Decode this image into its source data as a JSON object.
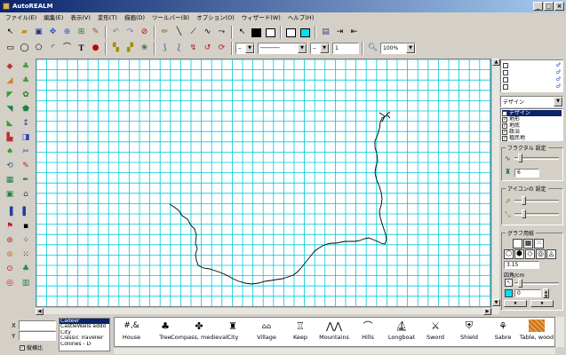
{
  "window": {
    "title": "AutoREALM"
  },
  "menu": [
    "ファイル(E)",
    "編集(E)",
    "表示(V)",
    "変形(T)",
    "描画(D)",
    "ツールバー(B)",
    "オプション(O)",
    "ウィザード(W)",
    "ヘルプ(H)"
  ],
  "toolbar2": {
    "line_width_value": "1",
    "zoom_value": "100%"
  },
  "right_panel": {
    "layer_select": "デザイン",
    "layers": [
      {
        "label": "デザイン",
        "checked": true,
        "selected": true
      },
      {
        "label": "地形",
        "checked": true
      },
      {
        "label": "地底",
        "checked": true
      },
      {
        "label": "政治",
        "checked": true
      },
      {
        "label": "植民地",
        "checked": true
      }
    ],
    "fractal_title": "フラクタル 設定",
    "fractal_value": "6",
    "icon_title": "アイコンの 設定",
    "grid_title": "グラフ用紙",
    "grid_value": "3.15",
    "grid_unit_label": "四角/cm",
    "grid_spin_value": "0"
  },
  "bottom": {
    "x_label": "X",
    "y_label": "Y",
    "checkbox_label": "縦横比",
    "styles": [
      "Cadeer",
      "CastleWalls addo",
      "City",
      "Classic Traveller",
      "Collines - D"
    ],
    "symbols": [
      "House",
      "Tree",
      "Compass, medieval",
      "City",
      "Village",
      "Keep",
      "Mountains",
      "Hills",
      "Longboat",
      "Sword",
      "Shield",
      "Sabre",
      "Table, wood"
    ]
  },
  "colors": {
    "grid": "#00c8d8",
    "title_start": "#0a246a",
    "title_end": "#a6caf0"
  }
}
